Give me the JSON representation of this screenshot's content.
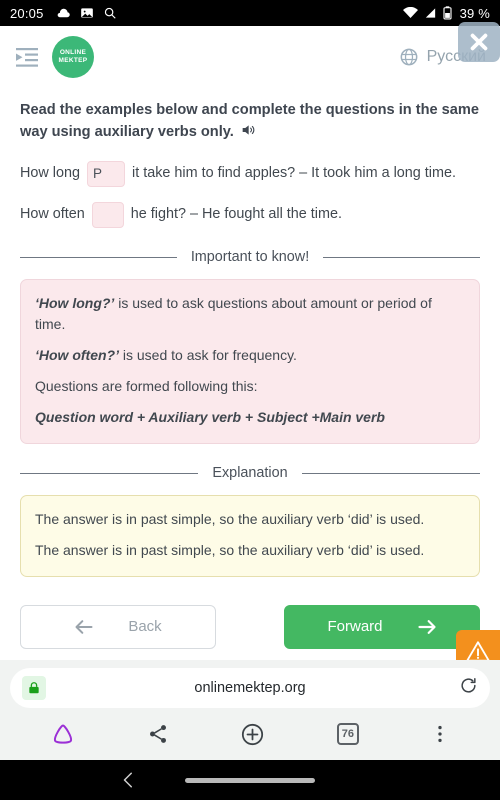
{
  "status_bar": {
    "time": "20:05",
    "battery_text": "39 %",
    "left_icons": [
      "cloud-icon",
      "image-icon",
      "search-icon"
    ],
    "right_icons": [
      "wifi-icon",
      "signal-icon",
      "battery-icon"
    ]
  },
  "header": {
    "menu_icon": "menu-indent-icon",
    "logo_line1": "ONLINE",
    "logo_line2": "MEKTEP",
    "logo_color": "#3cb878",
    "language_label": "Русский",
    "language_icon": "globe-icon",
    "close_icon": "close-icon"
  },
  "task": {
    "title": "Read the examples below and complete the questions in the same way using auxiliary verbs only.",
    "audio_icon": "speaker-icon",
    "questions": [
      {
        "before": "How long",
        "answer": "P",
        "after": "it take him to find apples? – It took him a long time."
      },
      {
        "before": "How often",
        "answer": "",
        "after": "he fight? – He fought all the time."
      }
    ]
  },
  "important_section": {
    "divider_label": "Important to know!",
    "box_color": "#fbe9ec",
    "paragraphs": [
      {
        "bold": "‘How long?’",
        "rest": " is used to ask questions about amount or period of time."
      },
      {
        "bold": "‘How often?’",
        "rest": " is used to ask for frequency."
      },
      {
        "bold": "",
        "rest": "Questions are formed following this:"
      },
      {
        "bold": "Question word + Auxiliary verb + Subject +Main verb",
        "rest": ""
      }
    ]
  },
  "explanation_section": {
    "divider_label": "Explanation",
    "box_color": "#fefce7",
    "lines": [
      "The answer is in past simple, so the auxiliary verb ‘did’ is used.",
      "The answer is in past simple, so the auxiliary verb ‘did’ is used."
    ]
  },
  "buttons": {
    "back_label": "Back",
    "back_icon": "arrow-left-icon",
    "forward_label": "Forward",
    "forward_icon": "arrow-right-icon",
    "forward_color": "#44b862",
    "warning_icon": "warning-triangle-icon",
    "warning_color": "#f3901d"
  },
  "browser": {
    "lock_icon": "lock-icon",
    "url": "onlinemektep.org",
    "reload_icon": "reload-icon",
    "toolbar": {
      "home_icon": "home-triangle-icon",
      "share_icon": "share-icon",
      "new_tab_icon": "plus-circle-icon",
      "tab_count": "76",
      "menu_icon": "overflow-menu-icon"
    }
  },
  "android_nav": {
    "back_icon": "nav-back-icon",
    "home_pill": "home-pill"
  }
}
